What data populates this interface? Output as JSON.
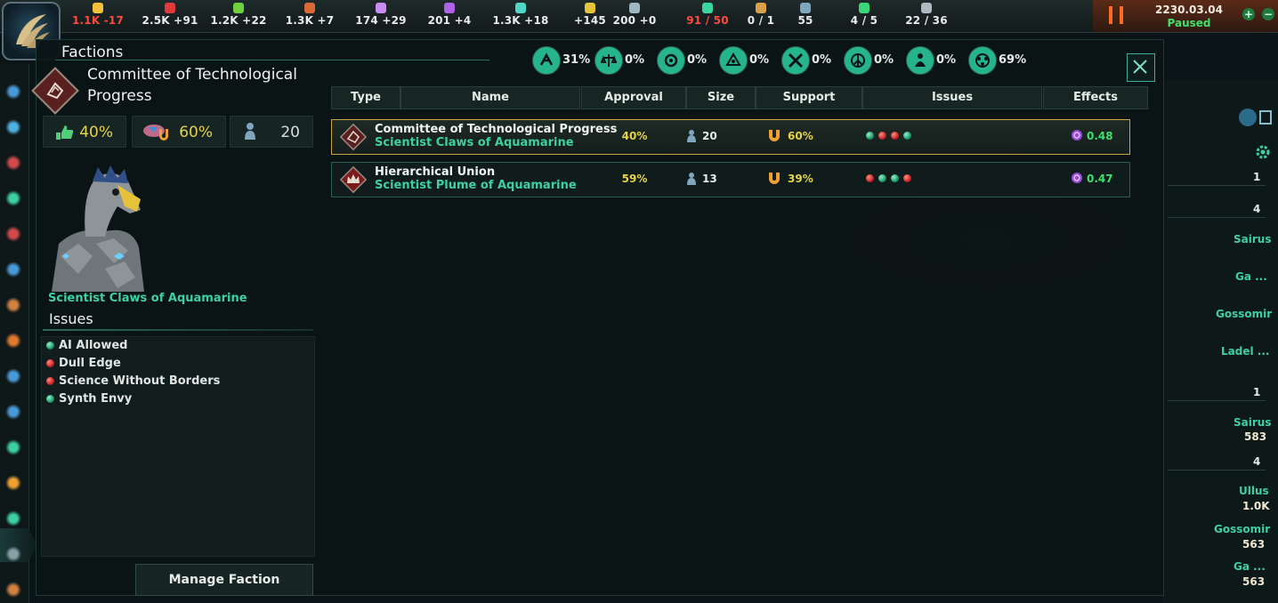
{
  "topbar": {
    "resources": [
      {
        "name": "energy-icon",
        "color": "#f3c13a",
        "value": "1.1K -17",
        "alert": true
      },
      {
        "name": "minerals-icon",
        "color": "#e23a3a",
        "value": "2.5K +91",
        "alert": false
      },
      {
        "name": "food-icon",
        "color": "#6fd13d",
        "value": "1.2K +22",
        "alert": false
      },
      {
        "name": "alloys-icon",
        "color": "#d96a38",
        "value": "1.3K +7",
        "alert": false
      },
      {
        "name": "consumer-goods-icon",
        "color": "#c88cf2",
        "value": "174 +29",
        "alert": false
      },
      {
        "name": "influence-icon",
        "color": "#b061e8",
        "value": "201 +4",
        "alert": false
      },
      {
        "name": "unity-icon",
        "color": "#4fd6c6",
        "value": "1.3K +18",
        "alert": false
      },
      {
        "name": "research-icon",
        "color": "#e5c43a",
        "value": "+145",
        "alert": false
      },
      {
        "name": "trade-icon",
        "color": "#9fb7c0",
        "value": "200 +0",
        "alert": false
      },
      {
        "name": "naval-capacity-icon",
        "color": "#3bd6a0",
        "value": "91 / 50",
        "alert": true
      },
      {
        "name": "starbase-capacity-icon",
        "color": "#d9a24a",
        "value": "0 / 1",
        "alert": false
      },
      {
        "name": "pops-icon",
        "color": "#7fa6bb",
        "value": "55",
        "alert": false
      },
      {
        "name": "planets-icon",
        "color": "#3bd67a",
        "value": "4 / 5",
        "alert": false
      },
      {
        "name": "systems-icon",
        "color": "#aeb9c2",
        "value": "22 / 36",
        "alert": false
      }
    ],
    "date": "2230.03.04",
    "status": "Paused"
  },
  "panel": {
    "title": "Factions"
  },
  "selected_faction": {
    "name": "Committee of Technological Progress",
    "approval": "40%",
    "support": "60%",
    "size": "20",
    "leader": "Scientist Claws of Aquamarine",
    "issues_title": "Issues",
    "issues": [
      {
        "label": "AI Allowed",
        "status": "green"
      },
      {
        "label": "Dull Edge",
        "status": "red"
      },
      {
        "label": "Science Without Borders",
        "status": "red"
      },
      {
        "label": "Synth Envy",
        "status": "green"
      }
    ],
    "manage_label": "Manage Faction"
  },
  "ethics": [
    {
      "name": "militarist-icon",
      "pct": "31%"
    },
    {
      "name": "egalitarian-icon",
      "pct": "0%"
    },
    {
      "name": "xenophile-icon",
      "pct": "0%"
    },
    {
      "name": "spiritualist-icon",
      "pct": "0%"
    },
    {
      "name": "xenophobe-icon",
      "pct": "0%"
    },
    {
      "name": "pacifist-icon",
      "pct": "0%"
    },
    {
      "name": "authoritarian-icon",
      "pct": "0%"
    },
    {
      "name": "materialist-icon",
      "pct": "69%"
    }
  ],
  "table": {
    "headers": [
      "Type",
      "Name",
      "Approval",
      "Size",
      "Support",
      "Issues",
      "Effects"
    ],
    "rows": [
      {
        "name": "Committee of Technological Progress",
        "leader": "Scientist Claws of Aquamarine",
        "approval": "40%",
        "size": "20",
        "support": "60%",
        "issues": [
          "green",
          "red",
          "red",
          "green"
        ],
        "effect": "0.48",
        "selected": true
      },
      {
        "name": "Hierarchical Union",
        "leader": "Scientist Plume of Aquamarine",
        "approval": "59%",
        "size": "13",
        "support": "39%",
        "issues": [
          "red",
          "green",
          "green",
          "red"
        ],
        "effect": "0.47",
        "selected": false
      }
    ]
  },
  "outliner": {
    "counts": [
      "1",
      "4",
      "1",
      "4"
    ],
    "planets": [
      {
        "name": "Sairus",
        "type": ""
      },
      {
        "name": "Ga ...",
        "type": ""
      },
      {
        "name": "Gossomir",
        "type": ""
      },
      {
        "name": "Ladel ...",
        "type": ""
      }
    ],
    "shipyard": {
      "name": "Sairus",
      "value": "583"
    },
    "starbases": [
      {
        "name": "Ullus",
        "value": "1.0K"
      },
      {
        "name": "Gossomir",
        "value": "563"
      },
      {
        "name": "Ga ...",
        "value": "563"
      }
    ]
  }
}
